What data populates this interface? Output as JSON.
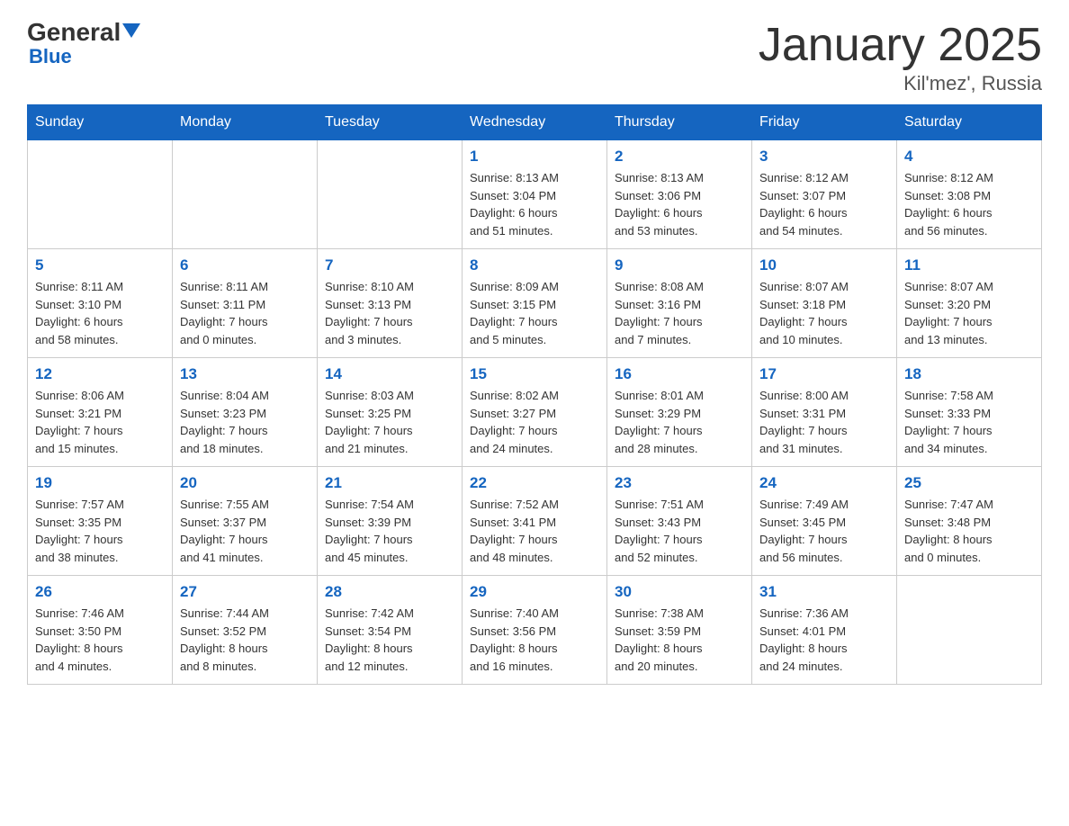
{
  "logo": {
    "general": "General",
    "arrow_color": "#1565c0",
    "blue": "Blue"
  },
  "header": {
    "month_title": "January 2025",
    "location": "Kil'mez', Russia"
  },
  "days_of_week": [
    "Sunday",
    "Monday",
    "Tuesday",
    "Wednesday",
    "Thursday",
    "Friday",
    "Saturday"
  ],
  "weeks": [
    [
      {
        "day": "",
        "info": ""
      },
      {
        "day": "",
        "info": ""
      },
      {
        "day": "",
        "info": ""
      },
      {
        "day": "1",
        "info": "Sunrise: 8:13 AM\nSunset: 3:04 PM\nDaylight: 6 hours\nand 51 minutes."
      },
      {
        "day": "2",
        "info": "Sunrise: 8:13 AM\nSunset: 3:06 PM\nDaylight: 6 hours\nand 53 minutes."
      },
      {
        "day": "3",
        "info": "Sunrise: 8:12 AM\nSunset: 3:07 PM\nDaylight: 6 hours\nand 54 minutes."
      },
      {
        "day": "4",
        "info": "Sunrise: 8:12 AM\nSunset: 3:08 PM\nDaylight: 6 hours\nand 56 minutes."
      }
    ],
    [
      {
        "day": "5",
        "info": "Sunrise: 8:11 AM\nSunset: 3:10 PM\nDaylight: 6 hours\nand 58 minutes."
      },
      {
        "day": "6",
        "info": "Sunrise: 8:11 AM\nSunset: 3:11 PM\nDaylight: 7 hours\nand 0 minutes."
      },
      {
        "day": "7",
        "info": "Sunrise: 8:10 AM\nSunset: 3:13 PM\nDaylight: 7 hours\nand 3 minutes."
      },
      {
        "day": "8",
        "info": "Sunrise: 8:09 AM\nSunset: 3:15 PM\nDaylight: 7 hours\nand 5 minutes."
      },
      {
        "day": "9",
        "info": "Sunrise: 8:08 AM\nSunset: 3:16 PM\nDaylight: 7 hours\nand 7 minutes."
      },
      {
        "day": "10",
        "info": "Sunrise: 8:07 AM\nSunset: 3:18 PM\nDaylight: 7 hours\nand 10 minutes."
      },
      {
        "day": "11",
        "info": "Sunrise: 8:07 AM\nSunset: 3:20 PM\nDaylight: 7 hours\nand 13 minutes."
      }
    ],
    [
      {
        "day": "12",
        "info": "Sunrise: 8:06 AM\nSunset: 3:21 PM\nDaylight: 7 hours\nand 15 minutes."
      },
      {
        "day": "13",
        "info": "Sunrise: 8:04 AM\nSunset: 3:23 PM\nDaylight: 7 hours\nand 18 minutes."
      },
      {
        "day": "14",
        "info": "Sunrise: 8:03 AM\nSunset: 3:25 PM\nDaylight: 7 hours\nand 21 minutes."
      },
      {
        "day": "15",
        "info": "Sunrise: 8:02 AM\nSunset: 3:27 PM\nDaylight: 7 hours\nand 24 minutes."
      },
      {
        "day": "16",
        "info": "Sunrise: 8:01 AM\nSunset: 3:29 PM\nDaylight: 7 hours\nand 28 minutes."
      },
      {
        "day": "17",
        "info": "Sunrise: 8:00 AM\nSunset: 3:31 PM\nDaylight: 7 hours\nand 31 minutes."
      },
      {
        "day": "18",
        "info": "Sunrise: 7:58 AM\nSunset: 3:33 PM\nDaylight: 7 hours\nand 34 minutes."
      }
    ],
    [
      {
        "day": "19",
        "info": "Sunrise: 7:57 AM\nSunset: 3:35 PM\nDaylight: 7 hours\nand 38 minutes."
      },
      {
        "day": "20",
        "info": "Sunrise: 7:55 AM\nSunset: 3:37 PM\nDaylight: 7 hours\nand 41 minutes."
      },
      {
        "day": "21",
        "info": "Sunrise: 7:54 AM\nSunset: 3:39 PM\nDaylight: 7 hours\nand 45 minutes."
      },
      {
        "day": "22",
        "info": "Sunrise: 7:52 AM\nSunset: 3:41 PM\nDaylight: 7 hours\nand 48 minutes."
      },
      {
        "day": "23",
        "info": "Sunrise: 7:51 AM\nSunset: 3:43 PM\nDaylight: 7 hours\nand 52 minutes."
      },
      {
        "day": "24",
        "info": "Sunrise: 7:49 AM\nSunset: 3:45 PM\nDaylight: 7 hours\nand 56 minutes."
      },
      {
        "day": "25",
        "info": "Sunrise: 7:47 AM\nSunset: 3:48 PM\nDaylight: 8 hours\nand 0 minutes."
      }
    ],
    [
      {
        "day": "26",
        "info": "Sunrise: 7:46 AM\nSunset: 3:50 PM\nDaylight: 8 hours\nand 4 minutes."
      },
      {
        "day": "27",
        "info": "Sunrise: 7:44 AM\nSunset: 3:52 PM\nDaylight: 8 hours\nand 8 minutes."
      },
      {
        "day": "28",
        "info": "Sunrise: 7:42 AM\nSunset: 3:54 PM\nDaylight: 8 hours\nand 12 minutes."
      },
      {
        "day": "29",
        "info": "Sunrise: 7:40 AM\nSunset: 3:56 PM\nDaylight: 8 hours\nand 16 minutes."
      },
      {
        "day": "30",
        "info": "Sunrise: 7:38 AM\nSunset: 3:59 PM\nDaylight: 8 hours\nand 20 minutes."
      },
      {
        "day": "31",
        "info": "Sunrise: 7:36 AM\nSunset: 4:01 PM\nDaylight: 8 hours\nand 24 minutes."
      },
      {
        "day": "",
        "info": ""
      }
    ]
  ]
}
